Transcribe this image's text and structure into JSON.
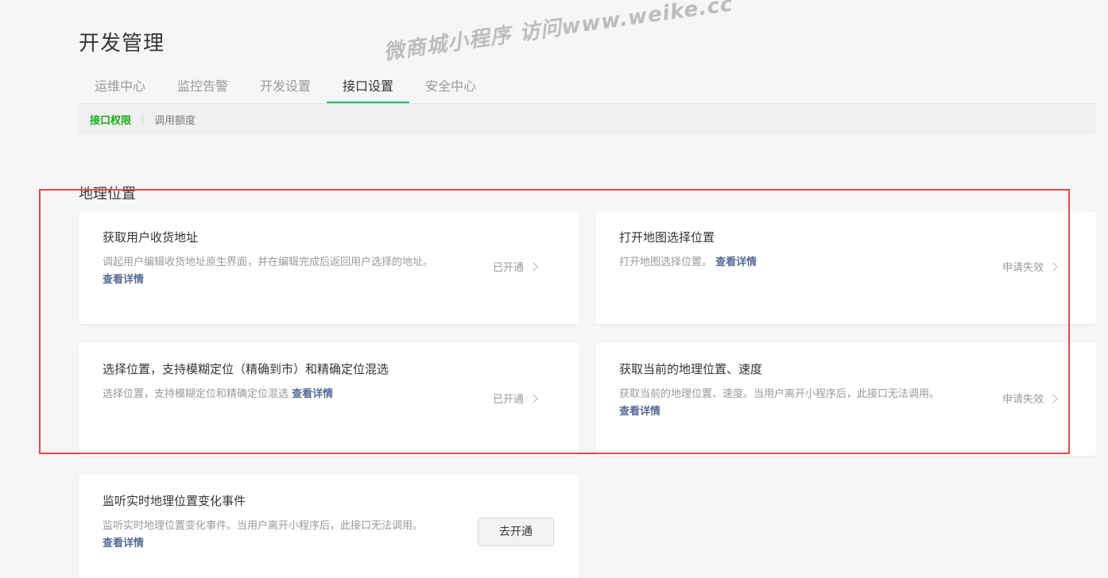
{
  "page": {
    "title": "开发管理"
  },
  "tabs": [
    {
      "label": "运维中心"
    },
    {
      "label": "监控告警"
    },
    {
      "label": "开发设置"
    },
    {
      "label": "接口设置",
      "active": true
    },
    {
      "label": "安全中心"
    }
  ],
  "subtabs": [
    {
      "label": "接口权限",
      "active": true
    },
    {
      "label": "调用额度"
    }
  ],
  "section": {
    "title": "地理位置"
  },
  "cards": [
    {
      "title": "获取用户收货地址",
      "desc": "调起用户编辑收货地址原生界面，并在编辑完成后返回用户选择的地址。",
      "link": "查看详情",
      "status": "已开通"
    },
    {
      "title": "打开地图选择位置",
      "desc": "打开地图选择位置。",
      "link": "查看详情",
      "status": "申请失效"
    },
    {
      "title": "选择位置，支持模糊定位（精确到市）和精确定位混选",
      "desc": "选择位置，支持模糊定位和精确定位混选",
      "link": "查看详情",
      "status": "已开通"
    },
    {
      "title": "获取当前的地理位置、速度",
      "desc": "获取当前的地理位置、速度。当用户离开小程序后，此接口无法调用。",
      "link": "查看详情",
      "status": "申请失效"
    },
    {
      "title": "监听实时地理位置变化事件",
      "desc": "监听实时地理位置变化事件。当用户离开小程序后，此接口无法调用。",
      "link": "查看详情",
      "button": "去开通"
    }
  ],
  "watermark": "微商城小程序 访问www.weike.cc",
  "colors": {
    "accent_green": "#07c160",
    "link_blue": "#576b95",
    "highlight_red": "#e8484c",
    "background": "#f6f6f6"
  }
}
